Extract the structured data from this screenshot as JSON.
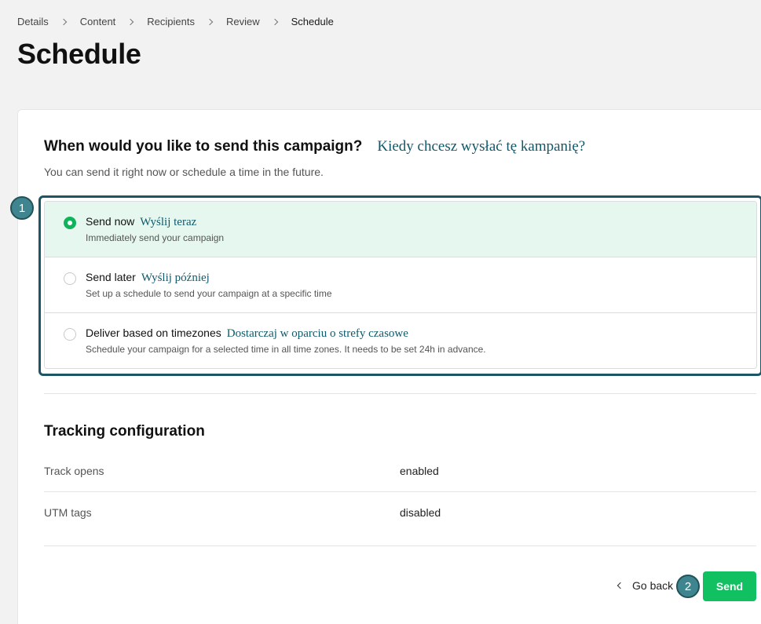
{
  "breadcrumb": {
    "items": [
      "Details",
      "Content",
      "Recipients",
      "Review",
      "Schedule"
    ]
  },
  "page": {
    "title": "Schedule"
  },
  "question": {
    "title": "When would you like to send this campaign?",
    "translation": "Kiedy chcesz wysłać tę kampanię?",
    "subtitle": "You can send it right now or schedule a time in the future."
  },
  "options": [
    {
      "label": "Send now",
      "translation": "Wyślij teraz",
      "description": "Immediately send your campaign",
      "selected": true
    },
    {
      "label": "Send later",
      "translation": "Wyślij później",
      "description": "Set up a schedule to send your campaign at a specific time",
      "selected": false
    },
    {
      "label": "Deliver based on timezones",
      "translation": "Dostarczaj w oparciu o strefy czasowe",
      "description": "Schedule your campaign for a selected time in all time zones. It needs to be set 24h in advance.",
      "selected": false
    }
  ],
  "tracking": {
    "title": "Tracking configuration",
    "rows": [
      {
        "label": "Track opens",
        "value": "enabled"
      },
      {
        "label": "UTM tags",
        "value": "disabled"
      }
    ]
  },
  "footer": {
    "back_label": "Go back",
    "send_label": "Send"
  },
  "annotations": {
    "badge_1": "1",
    "badge_2": "2"
  },
  "colors": {
    "accent": "#11c060",
    "selected_bg": "#e5f7ee",
    "highlight_frame": "#1d5565",
    "translation_text": "#0e5a6b"
  }
}
